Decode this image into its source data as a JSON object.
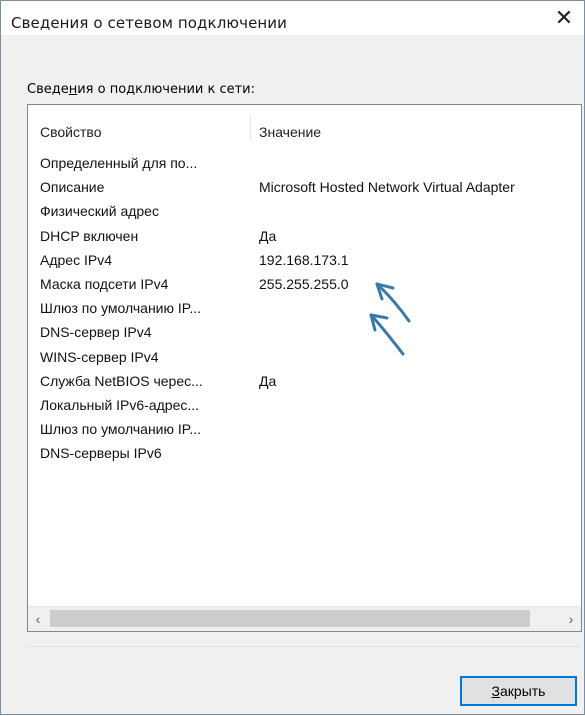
{
  "dialog": {
    "title": "Сведения о сетевом подключении",
    "close_glyph": "✕",
    "section_label_pre": "Сведе",
    "section_label_u": "н",
    "section_label_post": "ия о подключении к сети:",
    "close_button_pre": "",
    "close_button_u": "З",
    "close_button_post": "акрыть"
  },
  "table": {
    "columns": [
      "Свойство",
      "Значение"
    ],
    "rows": [
      {
        "property": "Определенный для по...",
        "value": ""
      },
      {
        "property": "Описание",
        "value": "Microsoft Hosted Network Virtual Adapter"
      },
      {
        "property": "Физический адрес",
        "value": ""
      },
      {
        "property": "DHCP включен",
        "value": "Да"
      },
      {
        "property": "Адрес IPv4",
        "value": "192.168.173.1"
      },
      {
        "property": "Маска подсети IPv4",
        "value": "255.255.255.0"
      },
      {
        "property": "Шлюз по умолчанию IP...",
        "value": ""
      },
      {
        "property": "DNS-сервер IPv4",
        "value": ""
      },
      {
        "property": "WINS-сервер IPv4",
        "value": ""
      },
      {
        "property": "Служба NetBIOS черес...",
        "value": "Да"
      },
      {
        "property": "Локальный IPv6-адрес...",
        "value": ""
      },
      {
        "property": "Шлюз по умолчанию IP...",
        "value": ""
      },
      {
        "property": "DNS-серверы IPv6",
        "value": ""
      }
    ]
  },
  "scrollbar": {
    "left_glyph": "‹",
    "right_glyph": "›"
  },
  "colors": {
    "accent": "#0078d7",
    "annotation_arrow": "#3a78a8"
  },
  "icons": [
    "close-icon",
    "scroll-left-icon",
    "scroll-right-icon",
    "annotation-arrow-icon"
  ]
}
